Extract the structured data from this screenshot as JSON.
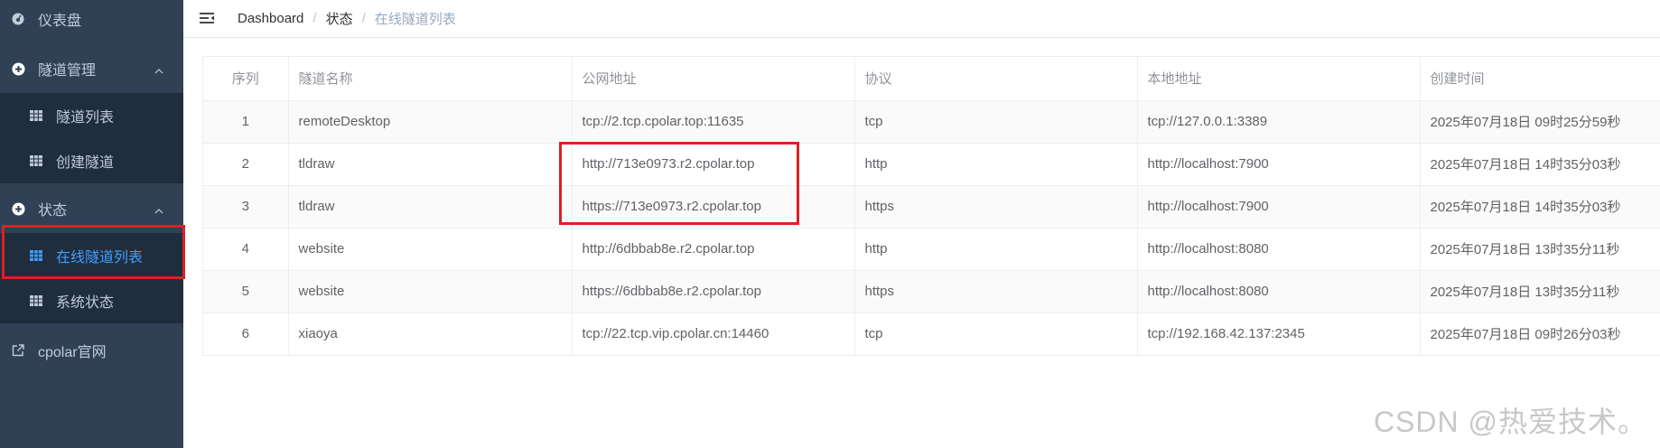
{
  "sidebar": {
    "items": [
      {
        "label": "仪表盘",
        "icon": "dashboard-icon"
      },
      {
        "label": "隧道管理",
        "icon": "plus-circle-icon"
      },
      {
        "label": "隧道列表",
        "icon": "table-icon"
      },
      {
        "label": "创建隧道",
        "icon": "table-icon"
      },
      {
        "label": "状态",
        "icon": "plus-circle-icon"
      },
      {
        "label": "在线隧道列表",
        "icon": "table-icon"
      },
      {
        "label": "系统状态",
        "icon": "table-icon"
      },
      {
        "label": "cpolar官网",
        "icon": "external-link-icon"
      }
    ],
    "colors": {
      "bg": "#304156",
      "submenu_bg": "#1f2d3d",
      "text": "#bfcbd9",
      "active": "#409eff"
    }
  },
  "navbar": {
    "breadcrumb": [
      "Dashboard",
      "状态",
      "在线隧道列表"
    ]
  },
  "table": {
    "headers": [
      "序列",
      "隧道名称",
      "公网地址",
      "协议",
      "本地地址",
      "创建时间"
    ],
    "rows": [
      [
        "1",
        "remoteDesktop",
        "tcp://2.tcp.cpolar.top:11635",
        "tcp",
        "tcp://127.0.0.1:3389",
        "2025年07月18日 09时25分59秒"
      ],
      [
        "2",
        "tldraw",
        "http://713e0973.r2.cpolar.top",
        "http",
        "http://localhost:7900",
        "2025年07月18日 14时35分03秒"
      ],
      [
        "3",
        "tldraw",
        "https://713e0973.r2.cpolar.top",
        "https",
        "http://localhost:7900",
        "2025年07月18日 14时35分03秒"
      ],
      [
        "4",
        "website",
        "http://6dbbab8e.r2.cpolar.top",
        "http",
        "http://localhost:8080",
        "2025年07月18日 13时35分11秒"
      ],
      [
        "5",
        "website",
        "https://6dbbab8e.r2.cpolar.top",
        "https",
        "http://localhost:8080",
        "2025年07月18日 13时35分11秒"
      ],
      [
        "6",
        "xiaoya",
        "tcp://22.tcp.vip.cpolar.cn:14460",
        "tcp",
        "tcp://192.168.42.137:2345",
        "2025年07月18日 09时26分03秒"
      ]
    ]
  },
  "watermark": "CSDN @热爱技术。",
  "highlight_color": "#e01f25"
}
